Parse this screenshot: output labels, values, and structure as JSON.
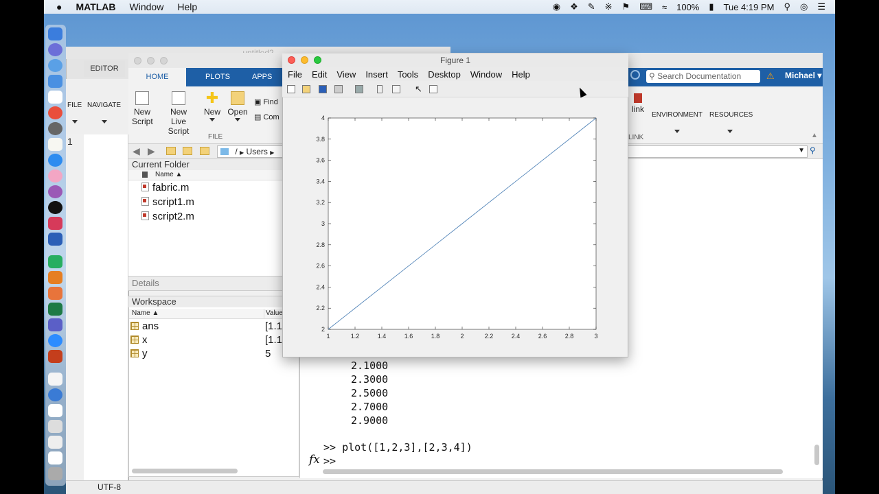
{
  "menubar": {
    "apple": "",
    "app": "MATLAB",
    "items": [
      "Window",
      "Help"
    ],
    "battery": "100%",
    "clock": "Tue 4:19 PM"
  },
  "back_window": {
    "title": "untitled2",
    "editor_tab": "EDITOR",
    "file_label": "FILE",
    "navigate_label": "NAVIGATE",
    "line_number": "1",
    "encoding": "UTF-8"
  },
  "matlab": {
    "tabs": [
      "HOME",
      "PLOTS",
      "APPS"
    ],
    "ribbon": {
      "new_script": [
        "New",
        "Script"
      ],
      "new_live_script": [
        "New",
        "Live Script"
      ],
      "new": "New",
      "open": "Open",
      "find": "Find",
      "compare": "Com",
      "file_section": "FILE",
      "simulink": "link",
      "link_section": "LINK",
      "environment": "ENVIRONMENT",
      "resources": "RESOURCES"
    },
    "search_placeholder": "Search Documentation",
    "user": "Michael",
    "path": [
      "/",
      "Users"
    ],
    "current_folder": {
      "title": "Current Folder",
      "column": "Name ▲",
      "files": [
        "fabric.m",
        "script1.m",
        "script2.m"
      ]
    },
    "details": "Details",
    "workspace": {
      "title": "Workspace",
      "col_name": "Name ▲",
      "col_value": "Value",
      "rows": [
        {
          "name": "ans",
          "value": "[1.1"
        },
        {
          "name": "x",
          "value": "[1.1"
        },
        {
          "name": "y",
          "value": "5"
        }
      ]
    },
    "command": {
      "outputs": [
        "2.1000",
        "2.3000",
        "2.5000",
        "2.7000",
        "2.9000"
      ],
      "last_command": ">> plot([1,2,3],[2,3,4])",
      "prompt": ">>",
      "fx": "fx"
    }
  },
  "figure": {
    "title": "Figure 1",
    "menu": [
      "File",
      "Edit",
      "View",
      "Insert",
      "Tools",
      "Desktop",
      "Window",
      "Help"
    ]
  },
  "chart_data": {
    "type": "line",
    "x": [
      1,
      2,
      3
    ],
    "series": [
      {
        "values": [
          2,
          3,
          4
        ]
      }
    ],
    "xlim": [
      1,
      3
    ],
    "ylim": [
      2,
      4
    ],
    "xticks": [
      "1",
      "1.2",
      "1.4",
      "1.6",
      "1.8",
      "2",
      "2.2",
      "2.4",
      "2.6",
      "2.8",
      "3"
    ],
    "yticks": [
      "2",
      "2.2",
      "2.4",
      "2.6",
      "2.8",
      "3",
      "3.2",
      "3.4",
      "3.6",
      "3.8",
      "4"
    ],
    "color": "#4a7fb5",
    "grid": false
  }
}
